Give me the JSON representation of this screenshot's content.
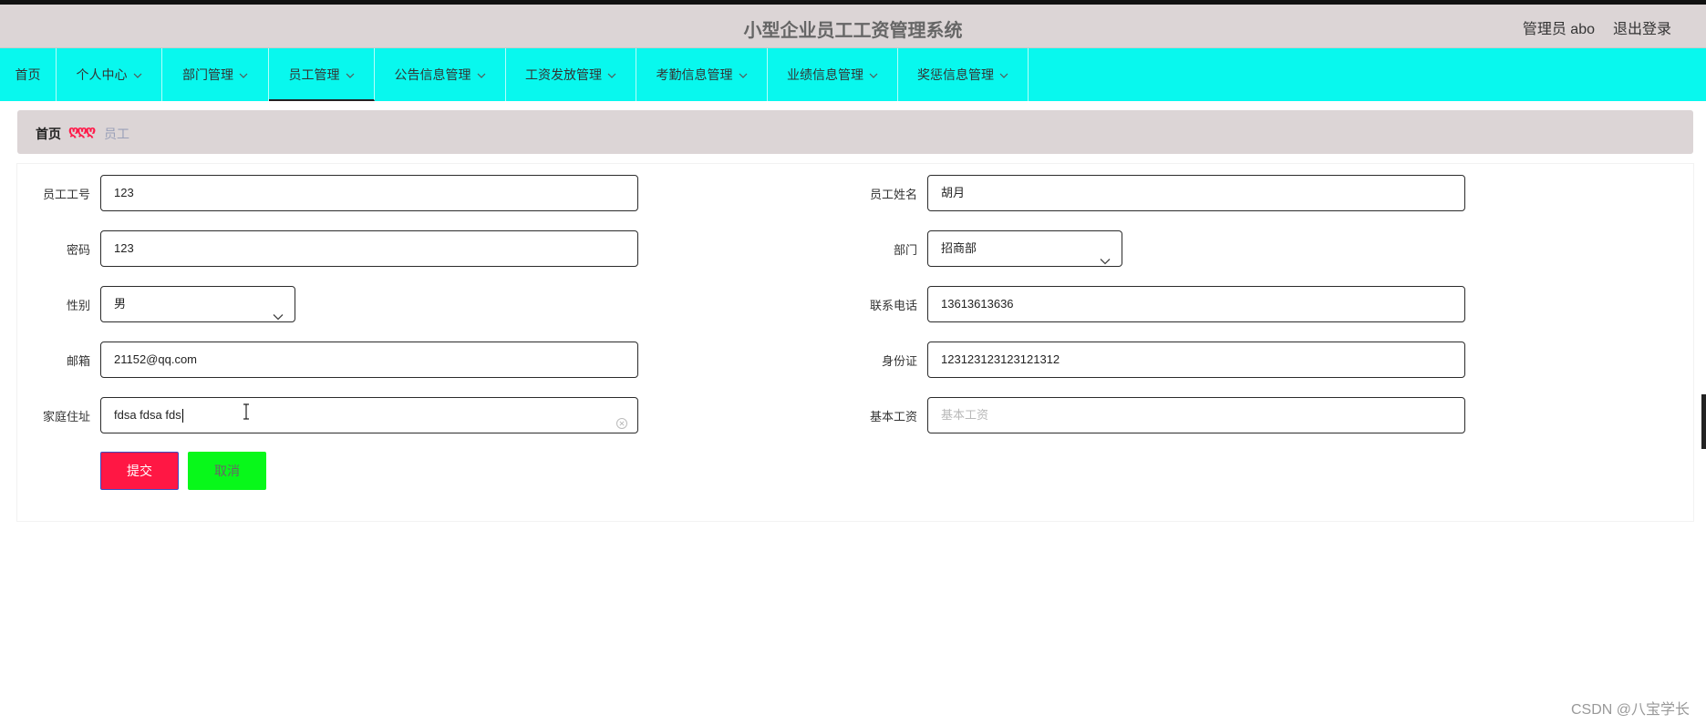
{
  "header": {
    "title": "小型企业员工工资管理系统",
    "user": "管理员 abo",
    "logout": "退出登录"
  },
  "nav": {
    "items": [
      {
        "label": "首页",
        "dropdown": false
      },
      {
        "label": "个人中心",
        "dropdown": true
      },
      {
        "label": "部门管理",
        "dropdown": true
      },
      {
        "label": "员工管理",
        "dropdown": true,
        "active": true
      },
      {
        "label": "公告信息管理",
        "dropdown": true
      },
      {
        "label": "工资发放管理",
        "dropdown": true
      },
      {
        "label": "考勤信息管理",
        "dropdown": true
      },
      {
        "label": "业绩信息管理",
        "dropdown": true
      },
      {
        "label": "奖惩信息管理",
        "dropdown": true
      }
    ]
  },
  "breadcrumb": {
    "home": "首页",
    "separator": "ღღღ",
    "current": "员工"
  },
  "form": {
    "employee_no": {
      "label": "员工工号",
      "value": "123"
    },
    "employee_name": {
      "label": "员工姓名",
      "value": "胡月"
    },
    "password": {
      "label": "密码",
      "value": "123"
    },
    "department": {
      "label": "部门",
      "value": "招商部"
    },
    "gender": {
      "label": "性别",
      "value": "男"
    },
    "phone": {
      "label": "联系电话",
      "value": "13613613636"
    },
    "email": {
      "label": "邮箱",
      "value": "21152@qq.com"
    },
    "id_card": {
      "label": "身份证",
      "value": "123123123123121312"
    },
    "address": {
      "label": "家庭住址",
      "value": "fdsa fdsa fds"
    },
    "base_salary": {
      "label": "基本工资",
      "placeholder": "基本工资"
    }
  },
  "buttons": {
    "submit": "提交",
    "cancel": "取消"
  },
  "watermark": "CSDN @八宝学长",
  "colors": {
    "nav_bg": "#08f8ee",
    "header_bg": "#dcd5d6",
    "submit": "#ff1744",
    "cancel": "#08f81a"
  }
}
